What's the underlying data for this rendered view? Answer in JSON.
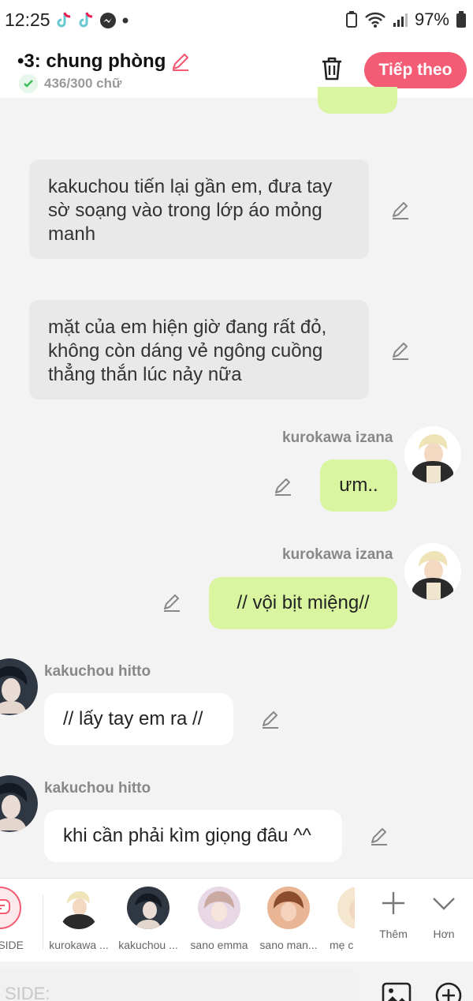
{
  "status_bar": {
    "time": "12:25",
    "battery": "97%"
  },
  "header": {
    "title": "•3: chung phòng",
    "word_count": "436/300 chữ",
    "next_label": "Tiếp theo"
  },
  "messages": {
    "narration_1": "kakuchou tiến lại gần em, đưa tay sờ soạng vào trong lớp áo mỏng manh",
    "narration_2": "mặt của em hiện giờ đang rất đỏ, không còn dáng vẻ ngông cuồng thẳng thắn lúc nảy nữa",
    "m3_name": "kurokawa izana",
    "m3_text": "ưm..",
    "m4_name": "kurokawa izana",
    "m4_text": "// vội bịt miệng//",
    "m5_name": "kakuchou hitto",
    "m5_text": "// lấy tay em ra //",
    "m6_name": "kakuchou hitto",
    "m6_text": "khi cần phải kìm giọng đâu ^^"
  },
  "characters": {
    "side_label": "SIDE",
    "items": [
      {
        "label": "kurokawa ..."
      },
      {
        "label": "kakuchou ..."
      },
      {
        "label": "sano emma"
      },
      {
        "label": "sano man..."
      },
      {
        "label": "mẹ c"
      }
    ],
    "add_label": "Thêm",
    "more_label": "Hơn"
  },
  "input": {
    "placeholder": "SIDE:"
  },
  "colors": {
    "accent": "#f35c74",
    "green_bubble": "#d9f59f",
    "narration_bg": "#e9e9e9"
  },
  "icons": [
    "tiktok-icon",
    "messenger-icon",
    "wifi-icon",
    "signal-icon",
    "battery-icon",
    "pencil-icon",
    "trash-icon",
    "plus-icon",
    "chevron-down-icon",
    "image-icon",
    "add-circle-icon"
  ]
}
